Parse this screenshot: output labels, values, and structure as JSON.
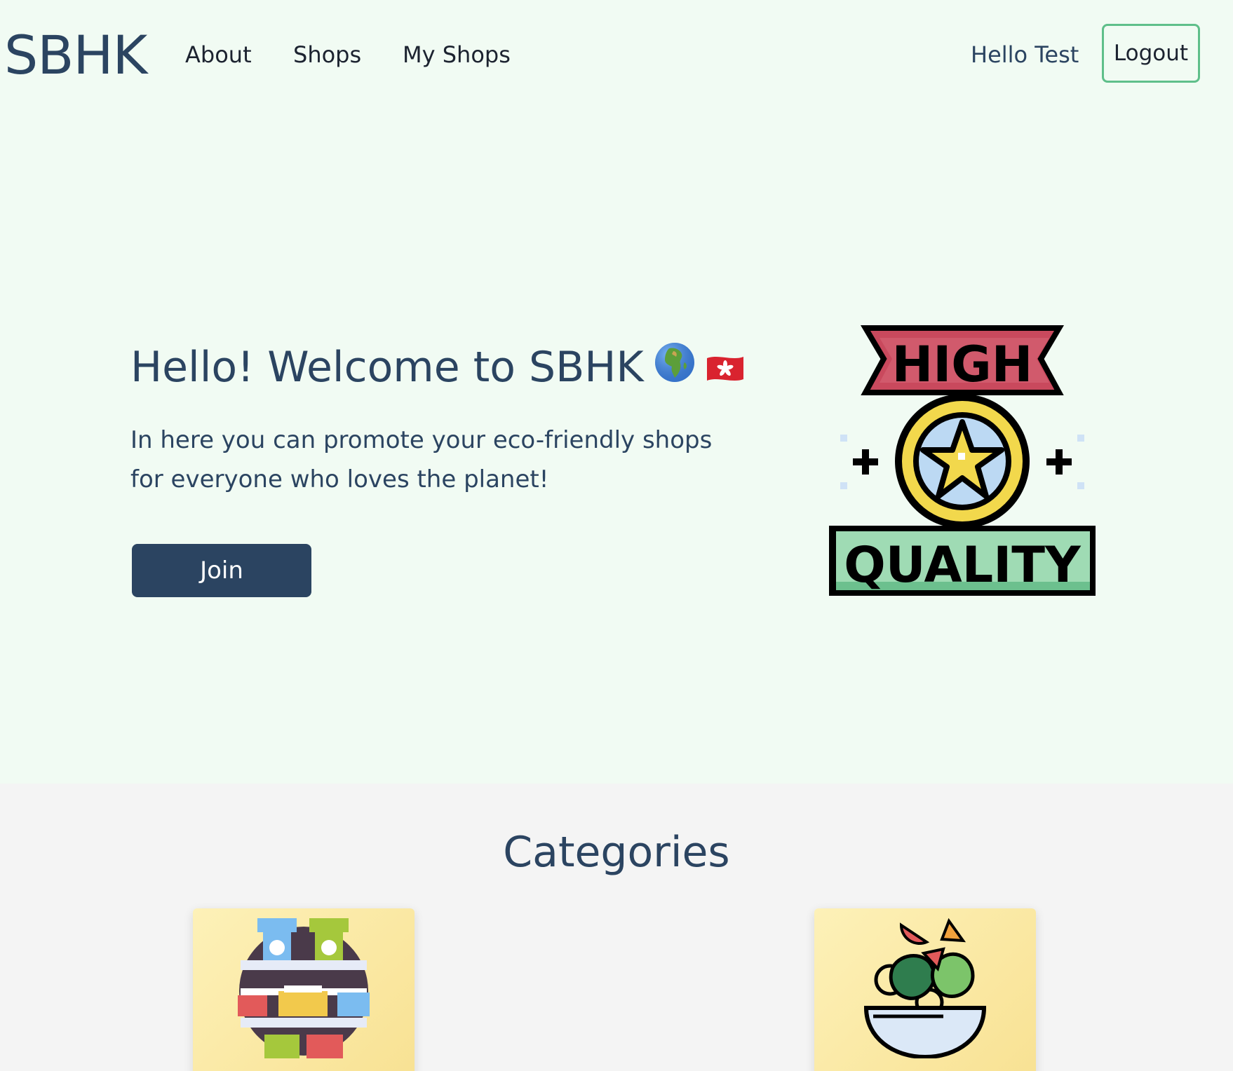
{
  "nav": {
    "brand": "SBHK",
    "links": [
      "About",
      "Shops",
      "My Shops"
    ],
    "greeting": "Hello Test",
    "logout_label": "Logout"
  },
  "hero": {
    "title": "Hello! Welcome to SBHK",
    "description": "In here you can promote your eco-friendly shops for everyone who loves the planet!",
    "join_label": "Join",
    "badge_top": "HIGH",
    "badge_bottom": "QUALITY",
    "emojis": [
      "globe-africa-icon",
      "hong-kong-flag-icon"
    ]
  },
  "categories": {
    "title": "Categories",
    "items": [
      {
        "icon": "pantry-shelf-icon"
      },
      {
        "icon": "salad-bowl-icon"
      }
    ]
  },
  "colors": {
    "top_background": "#f1fbf3",
    "section_background": "#f4f4f4",
    "primary": "#2b4461",
    "logout_border": "#5fbf8a",
    "card_gradient_start": "#fdf1b8",
    "card_gradient_end": "#f8e192"
  }
}
